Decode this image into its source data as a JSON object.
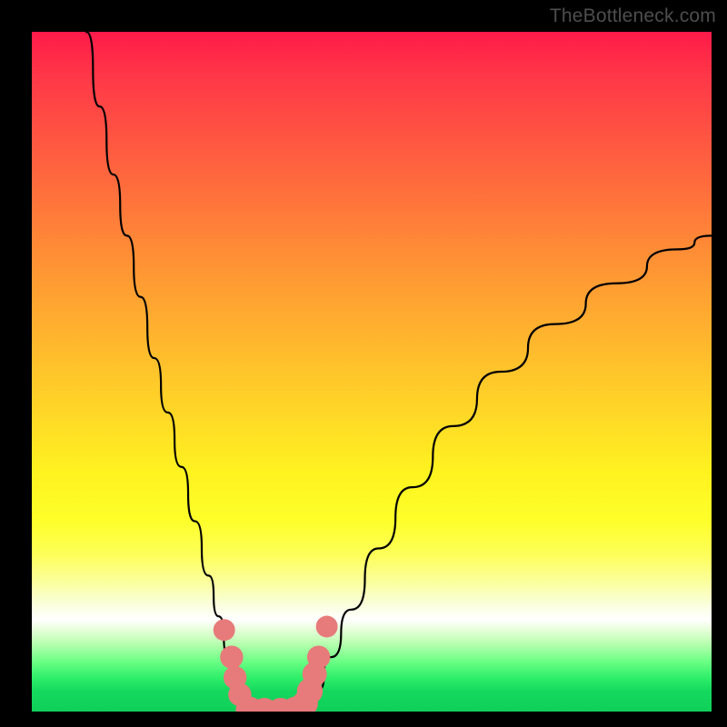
{
  "watermark": "TheBottleneck.com",
  "chart_data": {
    "type": "line",
    "title": "",
    "xlabel": "",
    "ylabel": "",
    "xlim": [
      0,
      100
    ],
    "ylim": [
      0,
      100
    ],
    "series": [
      {
        "name": "left-branch",
        "x": [
          8,
          10,
          12,
          14,
          16,
          18,
          20,
          22,
          24,
          26,
          27.5,
          29,
          30.5,
          31.5
        ],
        "values": [
          100,
          89,
          79,
          70,
          61,
          52,
          44,
          36,
          28,
          20,
          14,
          8,
          3,
          0
        ]
      },
      {
        "name": "right-branch",
        "x": [
          40.5,
          42,
          44,
          47,
          51,
          56,
          62,
          69,
          77,
          86,
          95,
          100
        ],
        "values": [
          0,
          3,
          8,
          15,
          24,
          33,
          42,
          50,
          57,
          63,
          68,
          70
        ]
      },
      {
        "name": "trough",
        "x": [
          31.5,
          33,
          35,
          37,
          39,
          40.5
        ],
        "values": [
          0,
          0,
          0,
          0,
          0,
          0
        ]
      }
    ],
    "markers": {
      "name": "highlight-dots",
      "color": "#e77a7a",
      "points": [
        {
          "x": 28.3,
          "y": 12.0,
          "r": 1.6
        },
        {
          "x": 29.4,
          "y": 8.0,
          "r": 1.7
        },
        {
          "x": 29.9,
          "y": 5.0,
          "r": 1.7
        },
        {
          "x": 30.6,
          "y": 2.5,
          "r": 1.7
        },
        {
          "x": 32.0,
          "y": 0.2,
          "r": 2.0
        },
        {
          "x": 34.2,
          "y": 0.0,
          "r": 2.0
        },
        {
          "x": 36.6,
          "y": 0.0,
          "r": 2.0
        },
        {
          "x": 38.8,
          "y": 0.2,
          "r": 2.0
        },
        {
          "x": 40.2,
          "y": 1.2,
          "r": 1.9
        },
        {
          "x": 40.9,
          "y": 3.0,
          "r": 1.9
        },
        {
          "x": 41.6,
          "y": 5.5,
          "r": 1.8
        },
        {
          "x": 42.2,
          "y": 8.0,
          "r": 1.7
        },
        {
          "x": 43.4,
          "y": 12.5,
          "r": 1.6
        }
      ]
    },
    "gradient_bands": [
      {
        "color": "#ff1a49",
        "pos": 0
      },
      {
        "color": "#ffb52e",
        "pos": 45
      },
      {
        "color": "#fff320",
        "pos": 65
      },
      {
        "color": "#ffffff",
        "pos": 86.5
      },
      {
        "color": "#0fcf59",
        "pos": 100
      }
    ]
  }
}
